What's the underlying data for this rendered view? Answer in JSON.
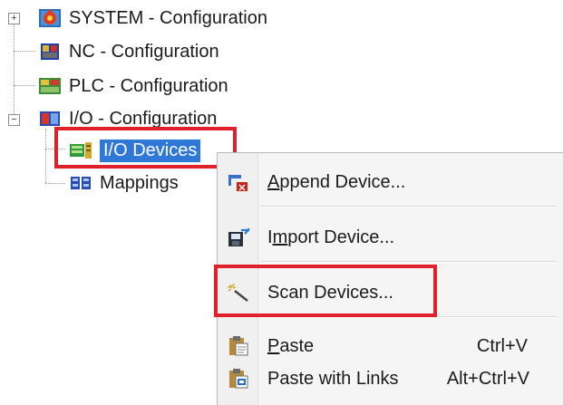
{
  "tree": {
    "system": {
      "label": "SYSTEM - Configuration",
      "expander": "+",
      "icon": "system-config-icon"
    },
    "nc": {
      "label": "NC - Configuration",
      "icon": "nc-config-icon"
    },
    "plc": {
      "label": "PLC - Configuration",
      "icon": "plc-config-icon"
    },
    "io": {
      "label": "I/O - Configuration",
      "expander": "−",
      "icon": "io-config-icon"
    },
    "io_devices": {
      "label": "I/O Devices",
      "icon": "io-devices-icon"
    },
    "mappings": {
      "label": "Mappings",
      "icon": "mappings-icon"
    }
  },
  "context_menu": {
    "items": [
      {
        "label_pre": "",
        "label_key": "A",
        "label_post": "ppend Device...",
        "shortcut": "",
        "icon": "append-device-icon"
      },
      {
        "label_pre": "I",
        "label_key": "m",
        "label_post": "port Device...",
        "shortcut": "",
        "icon": "import-device-icon"
      },
      {
        "label_pre": "",
        "label_key": "",
        "label_post": "Scan Devices...",
        "shortcut": "",
        "icon": "scan-wand-icon"
      },
      {
        "label_pre": "",
        "label_key": "P",
        "label_post": "aste",
        "shortcut": "Ctrl+V",
        "icon": "paste-icon"
      },
      {
        "label_pre": "Paste with Links",
        "label_key": "",
        "label_post": "",
        "shortcut": "Alt+Ctrl+V",
        "icon": "paste-links-icon"
      }
    ]
  },
  "colors": {
    "highlight_frame": "#e0202a",
    "selection": "#2f78d6",
    "menu_background": "#f5f5f5"
  }
}
